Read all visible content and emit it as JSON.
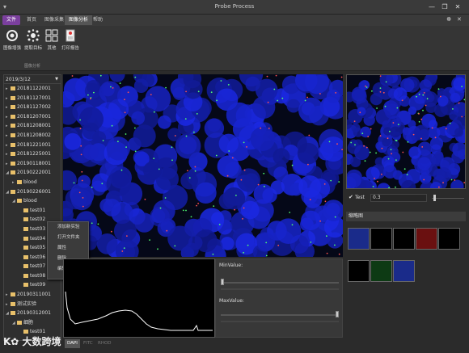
{
  "window": {
    "title": "Probe Process"
  },
  "menu": {
    "tabs": [
      {
        "label": "文件"
      },
      {
        "label": "首页"
      },
      {
        "label": "图像采集"
      },
      {
        "label": "图像分析"
      },
      {
        "label": "帮助"
      }
    ],
    "active_tab": "图像分析"
  },
  "ribbon": {
    "buttons": [
      {
        "label": "图像增强",
        "icon": "image-enhance-icon"
      },
      {
        "label": "提取目标",
        "icon": "extract-target-icon"
      },
      {
        "label": "其他",
        "icon": "grid-icon"
      },
      {
        "label": "打印报告",
        "icon": "print-report-icon"
      }
    ],
    "group_label": "图像分析"
  },
  "tree": {
    "date": "2019/3/12",
    "items": [
      {
        "label": "20181122001",
        "level": 0,
        "expanded": false
      },
      {
        "label": "20181127001",
        "level": 0,
        "expanded": false
      },
      {
        "label": "20181127002",
        "level": 0,
        "expanded": false
      },
      {
        "label": "20181207001",
        "level": 0,
        "expanded": false
      },
      {
        "label": "20181208001",
        "level": 0,
        "expanded": false
      },
      {
        "label": "20181208002",
        "level": 0,
        "expanded": false
      },
      {
        "label": "20181221001",
        "level": 0,
        "expanded": false
      },
      {
        "label": "20181225001",
        "level": 0,
        "expanded": false
      },
      {
        "label": "20190118001",
        "level": 0,
        "expanded": false
      },
      {
        "label": "20190222001",
        "level": 0,
        "expanded": true
      },
      {
        "label": "blood",
        "level": 1,
        "expanded": false
      },
      {
        "label": "20190226001",
        "level": 0,
        "expanded": true
      },
      {
        "label": "blood",
        "level": 1,
        "expanded": true
      },
      {
        "label": "test01",
        "level": 2
      },
      {
        "label": "test02",
        "level": 2
      },
      {
        "label": "test03",
        "level": 2
      },
      {
        "label": "test04",
        "level": 2
      },
      {
        "label": "test05",
        "level": 2
      },
      {
        "label": "test06",
        "level": 2
      },
      {
        "label": "test07",
        "level": 2
      },
      {
        "label": "test08",
        "level": 2
      },
      {
        "label": "test09",
        "level": 2
      },
      {
        "label": "20190311001",
        "level": 0,
        "expanded": false
      },
      {
        "label": "测试实验",
        "level": 0,
        "expanded": false
      },
      {
        "label": "20190312001",
        "level": 0,
        "expanded": true
      },
      {
        "label": "细胞",
        "level": 1,
        "expanded": true
      },
      {
        "label": "test01",
        "level": 2
      }
    ]
  },
  "context_menu": {
    "items": [
      {
        "label": "添加新实验"
      },
      {
        "label": "打开文件夹"
      },
      {
        "label": "属性"
      },
      {
        "label": "删除"
      },
      {
        "label": "编辑"
      }
    ]
  },
  "sliders": {
    "min_label": "MinValue:",
    "max_label": "MaxValue:",
    "min_value": 0.0,
    "max_value": 1.0
  },
  "channels": {
    "tabs": [
      {
        "label": "DAPI"
      },
      {
        "label": "FITC"
      },
      {
        "label": "RHOD"
      }
    ],
    "active": "DAPI"
  },
  "test_row": {
    "label": "Test",
    "value": "0.3",
    "checked": true
  },
  "thumbnails": {
    "header": "缩略图",
    "row1_colors": [
      "#1a2b8a",
      "#000000",
      "#000000",
      "#6a1010",
      "#000000"
    ],
    "row2_colors": [
      "#000000",
      "#0d3a14",
      "#1a2b8a"
    ]
  },
  "watermark": {
    "text": "大数跨境"
  },
  "colors": {
    "file_tab": "#7b3f9e",
    "background": "#2b2b2b",
    "cell_blue": "#1a2b8a"
  }
}
